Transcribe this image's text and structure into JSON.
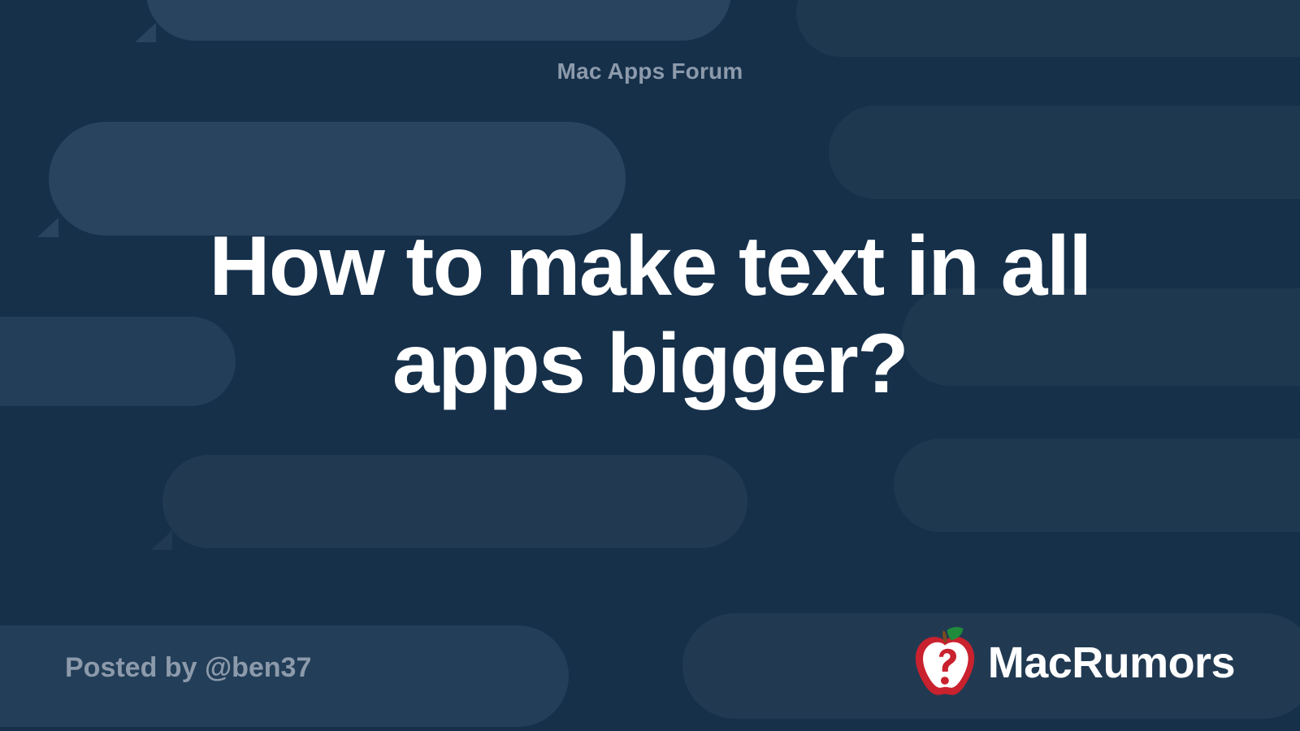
{
  "category": "Mac Apps Forum",
  "title": "How to make text in all apps bigger?",
  "posted_by_prefix": "Posted by ",
  "posted_by_handle": "@ben37",
  "brand": "MacRumors"
}
